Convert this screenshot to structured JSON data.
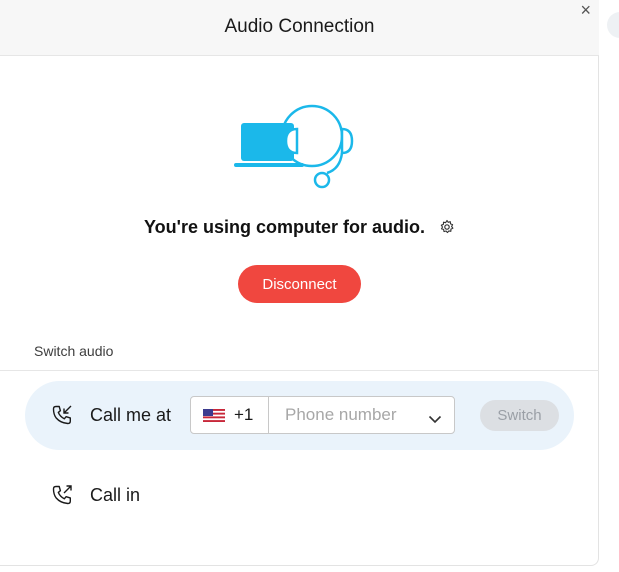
{
  "dialog": {
    "title": "Audio Connection",
    "close_symbol": "×"
  },
  "status": {
    "text": "You're using computer for audio.",
    "illustration_icon": "laptop-headset-icon",
    "settings_icon": "gear-icon"
  },
  "disconnect_label": "Disconnect",
  "switch_section": {
    "label": "Switch audio",
    "call_me": {
      "icon": "phone-incoming-icon",
      "label": "Call me at",
      "country_flag": "us-flag-icon",
      "country_code": "+1",
      "phone_value": "",
      "phone_placeholder": "Phone number",
      "switch_label": "Switch"
    },
    "call_in": {
      "icon": "phone-outgoing-icon",
      "label": "Call in"
    }
  },
  "colors": {
    "accent": "#1bb8ea",
    "danger": "#f0473f",
    "row_highlight": "#eaf3fb"
  }
}
